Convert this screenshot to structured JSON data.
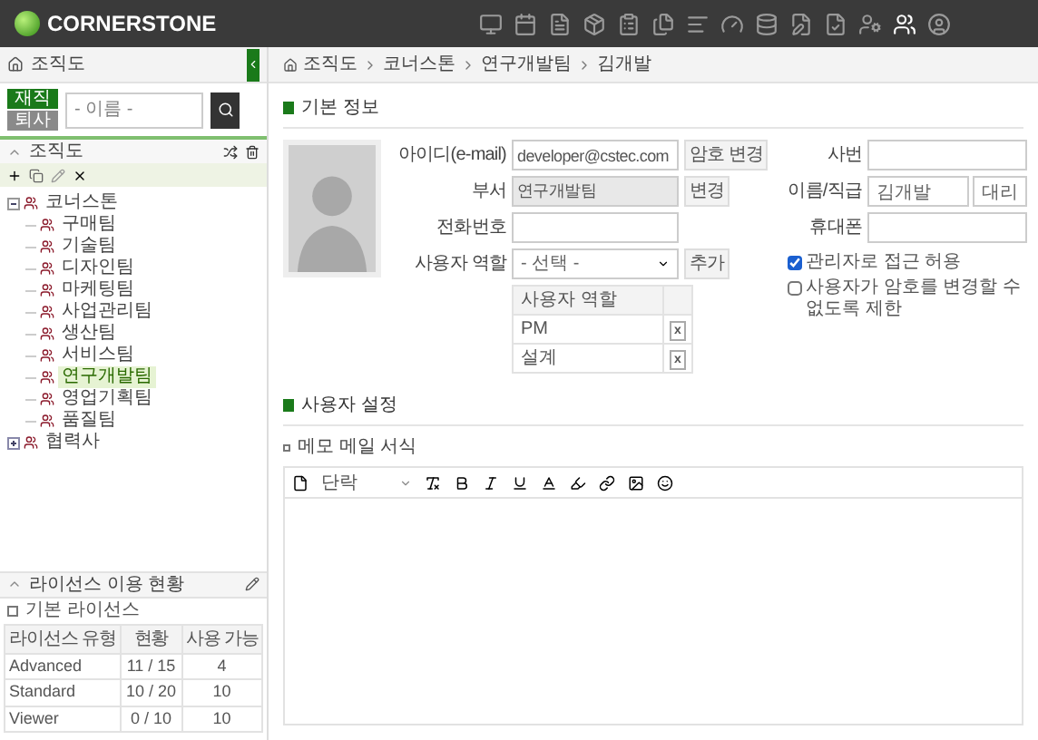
{
  "header": {
    "logo": "CORNERSTONE",
    "nav_icons": [
      {
        "selected": false
      },
      {
        "selected": false
      },
      {
        "selected": false
      },
      {
        "selected": false
      },
      {
        "selected": false
      },
      {
        "selected": false
      },
      {
        "selected": false
      },
      {
        "selected": false
      },
      {
        "selected": false
      },
      {
        "selected": false
      },
      {
        "selected": false
      },
      {
        "selected": false
      },
      {
        "selected": true
      },
      {
        "selected": false
      }
    ]
  },
  "sidebar": {
    "title": "조직도",
    "status_tabs": [
      {
        "label": "재직",
        "selected": true
      },
      {
        "label": "퇴사",
        "selected": false
      }
    ],
    "search": {
      "placeholder": "- 이름 -"
    },
    "org_panel": {
      "title": "조직도",
      "tree": [
        {
          "label": "코너스톤",
          "expanded": true,
          "selected": false,
          "children": [
            {
              "label": "구매팀",
              "selected": false
            },
            {
              "label": "기술팀",
              "selected": false
            },
            {
              "label": "디자인팀",
              "selected": false
            },
            {
              "label": "마케팅팀",
              "selected": false
            },
            {
              "label": "사업관리팀",
              "selected": false
            },
            {
              "label": "생산팀",
              "selected": false
            },
            {
              "label": "서비스팀",
              "selected": false
            },
            {
              "label": "연구개발팀",
              "selected": true
            },
            {
              "label": "영업기획팀",
              "selected": false
            },
            {
              "label": "품질팀",
              "selected": false
            }
          ]
        },
        {
          "label": "협력사",
          "expanded": false,
          "selected": false
        }
      ]
    },
    "license_panel": {
      "title": "라이선스 이용 현황",
      "subtitle": "기본 라이선스",
      "columns": [
        "라이선스 유형",
        "현황",
        "사용 가능"
      ],
      "rows": [
        [
          "Advanced",
          "11 / 15",
          "4"
        ],
        [
          "Standard",
          "10 / 20",
          "10"
        ],
        [
          "Viewer",
          "0 / 10",
          "10"
        ]
      ]
    }
  },
  "breadcrumb": [
    "조직도",
    "코너스톤",
    "연구개발팀",
    "김개발"
  ],
  "basic_info": {
    "title": "기본 정보",
    "left_fields": [
      {
        "kind": "input",
        "label": "아이디(e-mail)",
        "value": "developer@cstec.com",
        "disabled": false,
        "button": "암호 변경"
      },
      {
        "kind": "input",
        "label": "부서",
        "value": "연구개발팀",
        "disabled": true,
        "button": "변경"
      },
      {
        "kind": "input",
        "label": "전화번호",
        "disabled": false
      },
      {
        "kind": "select",
        "label": "사용자 역할",
        "value": "- 선택 -",
        "disabled": false,
        "button": "추가"
      }
    ],
    "roles_table": {
      "column": "사용자 역할",
      "rows": [
        {
          "role": "PM",
          "remove": "x"
        },
        {
          "role": "설계",
          "remove": "x"
        }
      ]
    },
    "right_fields": [
      {
        "label": "사번"
      },
      {
        "label": "이름/직급",
        "values": [
          "김개발",
          "대리"
        ]
      },
      {
        "label": "휴대폰"
      }
    ],
    "checkboxes": [
      {
        "label": "관리자로 접근 허용",
        "checked": true
      },
      {
        "label": "사용자가 암호를 변경할 수 없도록 제한",
        "checked": false
      }
    ]
  },
  "user_settings": {
    "title": "사용자 설정",
    "memo_title": "메모 메일 서식",
    "editor": {
      "paragraph_select": "단락"
    }
  }
}
